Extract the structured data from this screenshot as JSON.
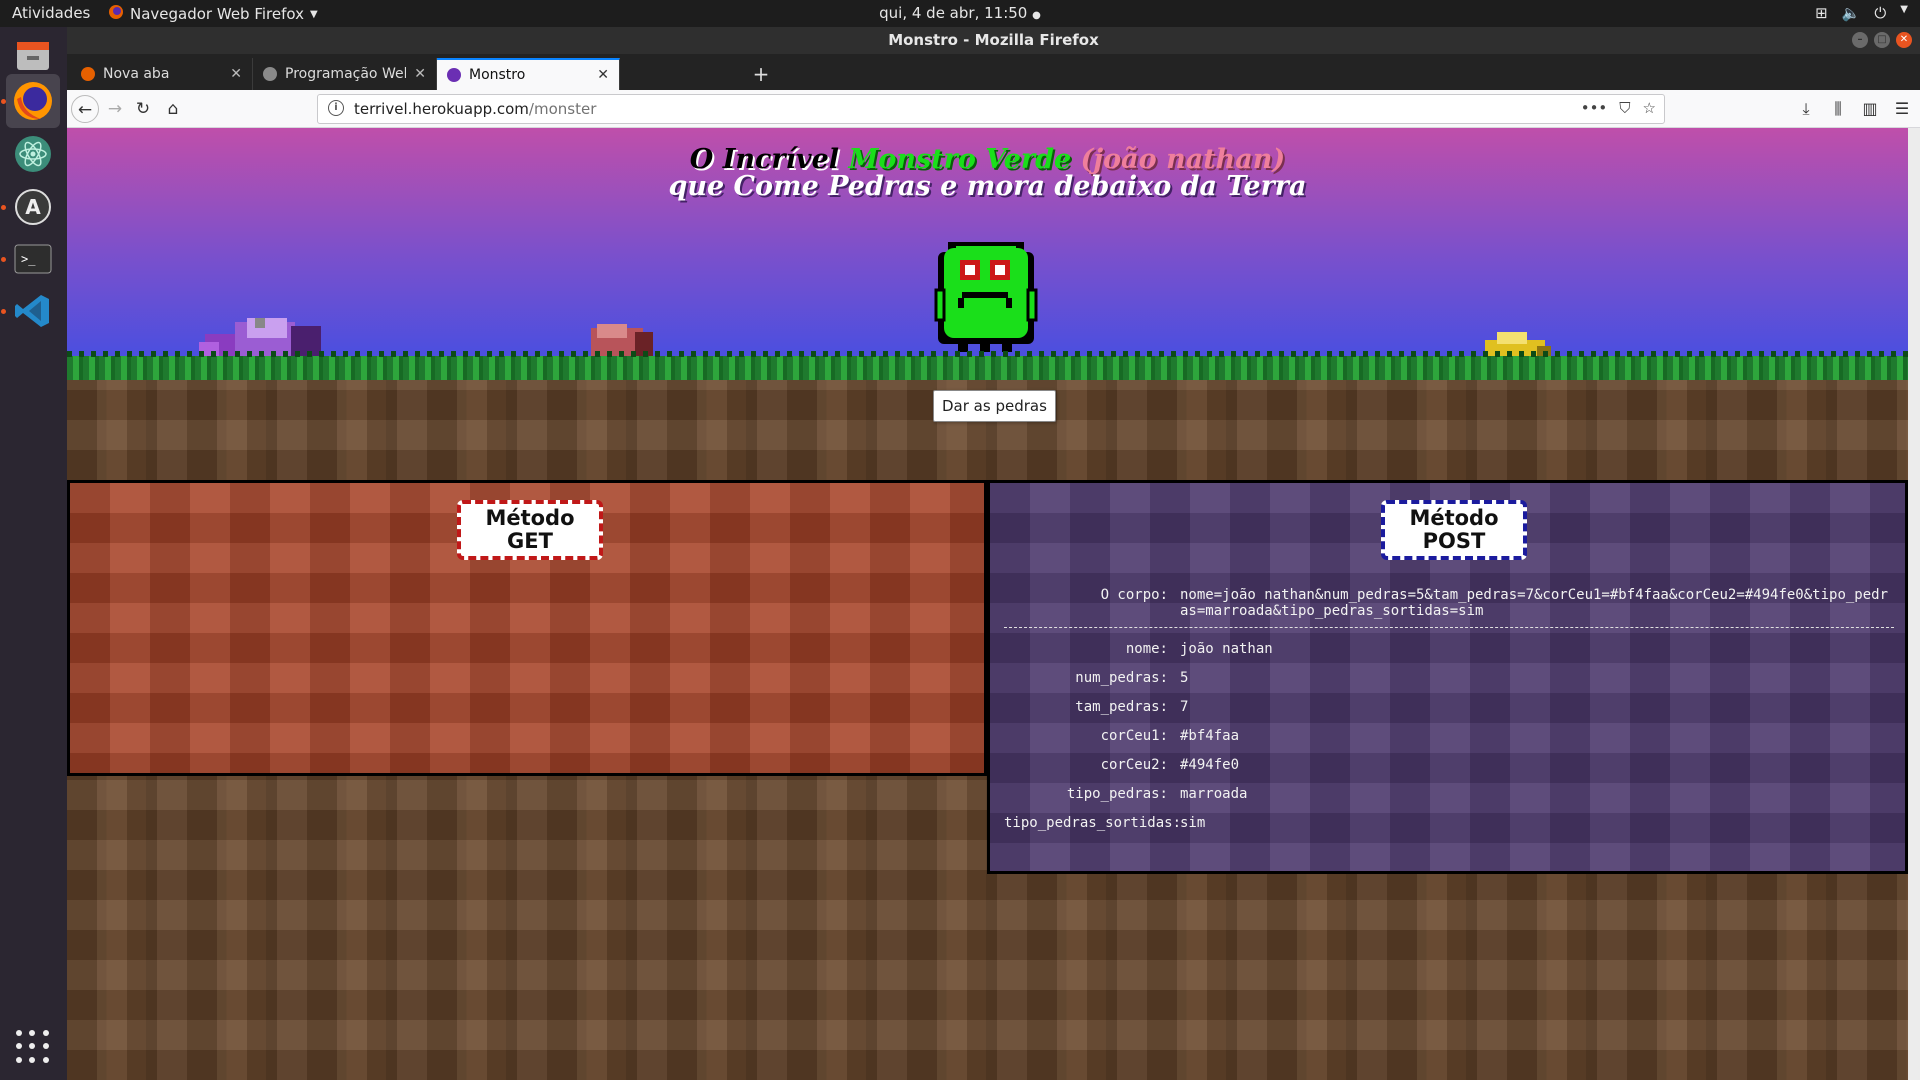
{
  "os": {
    "activities": "Atividades",
    "app_menu": "Navegador Web Firefox",
    "clock": "qui, 4 de abr, 11:50",
    "tray_icons": [
      "network-icon",
      "volume-icon",
      "power-icon"
    ]
  },
  "dock": {
    "items": [
      "file-manager-icon",
      "firefox-icon",
      "atom-icon",
      "software-updater-icon",
      "terminal-icon",
      "vscode-icon"
    ],
    "apps_grid": "show-applications-icon"
  },
  "window": {
    "title": "Monstro - Mozilla Firefox"
  },
  "tabs": [
    {
      "label": "Nova aba",
      "favicon_color": "#e66000"
    },
    {
      "label": "Programação Web",
      "favicon_color": "#8a8a8a"
    },
    {
      "label": "Monstro",
      "favicon_color": "#6b2fb3",
      "active": true
    }
  ],
  "url": {
    "host": "terrivel.herokuapp.com",
    "path": "/monster"
  },
  "page": {
    "title_prefix": "O Incrível",
    "title_monster": "Monstro Verde",
    "title_owner": "(joão nathan)",
    "title_line2": "que Come Pedras e mora debaixo da Terra",
    "feed_button": "Dar as pedras",
    "sky_colors": [
      "#bf4faa",
      "#494fe0"
    ],
    "monster_color": "#1adf1a",
    "rocks": [
      {
        "name": "purple-rock",
        "color": "#a05cd1"
      },
      {
        "name": "red-rock",
        "color": "#b8545a"
      },
      {
        "name": "yellow-rock",
        "color": "#e0c020"
      }
    ]
  },
  "get_panel": {
    "title": "Método GET"
  },
  "post_panel": {
    "title_line1": "Método",
    "title_line2": "POST",
    "body_label": "O corpo:",
    "body_value": "nome=joão nathan&num_pedras=5&tam_pedras=7&corCeu1=#bf4faa&corCeu2=#494fe0&tipo_pedras=marroada&tipo_pedras_sortidas=sim",
    "fields": [
      {
        "key": "nome:",
        "value": "joão nathan"
      },
      {
        "key": "num_pedras:",
        "value": "5"
      },
      {
        "key": "tam_pedras:",
        "value": "7"
      },
      {
        "key": "corCeu1:",
        "value": "#bf4faa"
      },
      {
        "key": "corCeu2:",
        "value": "#494fe0"
      },
      {
        "key": "tipo_pedras:",
        "value": "marroada"
      },
      {
        "key": "tipo_pedras_sortidas:",
        "value": "sim"
      }
    ]
  }
}
